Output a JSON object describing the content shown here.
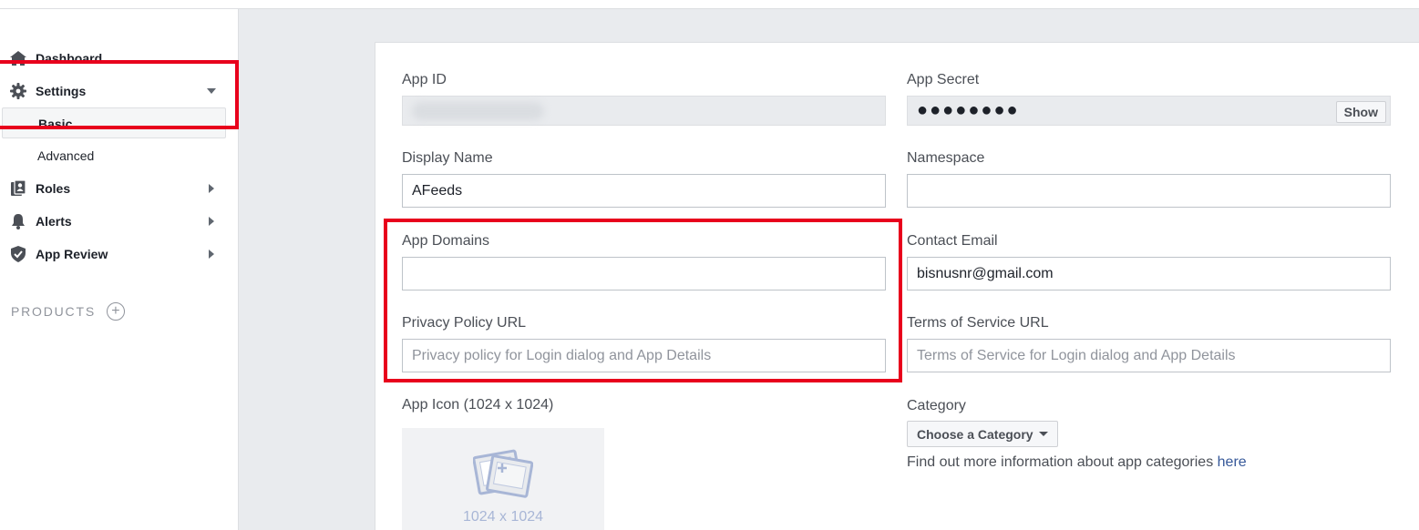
{
  "sidebar": {
    "dashboard": "Dashboard",
    "settings": "Settings",
    "settings_sub": [
      "Basic",
      "Advanced"
    ],
    "roles": "Roles",
    "alerts": "Alerts",
    "app_review": "App Review",
    "products": "PRODUCTS"
  },
  "form": {
    "app_id_label": "App ID",
    "app_secret_label": "App Secret",
    "app_secret_value": "●●●●●●●●",
    "show_button": "Show",
    "display_name_label": "Display Name",
    "display_name_value": "AFeeds",
    "namespace_label": "Namespace",
    "namespace_value": "",
    "app_domains_label": "App Domains",
    "app_domains_value": "",
    "contact_email_label": "Contact Email",
    "contact_email_value": "bisnusnr@gmail.com",
    "privacy_label": "Privacy Policy URL",
    "privacy_placeholder": "Privacy policy for Login dialog and App Details",
    "tos_label": "Terms of Service URL",
    "tos_placeholder": "Terms of Service for Login dialog and App Details",
    "app_icon_label": "App Icon (1024 x 1024)",
    "app_icon_size": "1024 x 1024",
    "category_label": "Category",
    "category_button": "Choose a Category",
    "category_info": "Find out more information about app categories",
    "category_link": "here"
  },
  "colors": {
    "highlight": "#e8001c",
    "link": "#365899"
  }
}
